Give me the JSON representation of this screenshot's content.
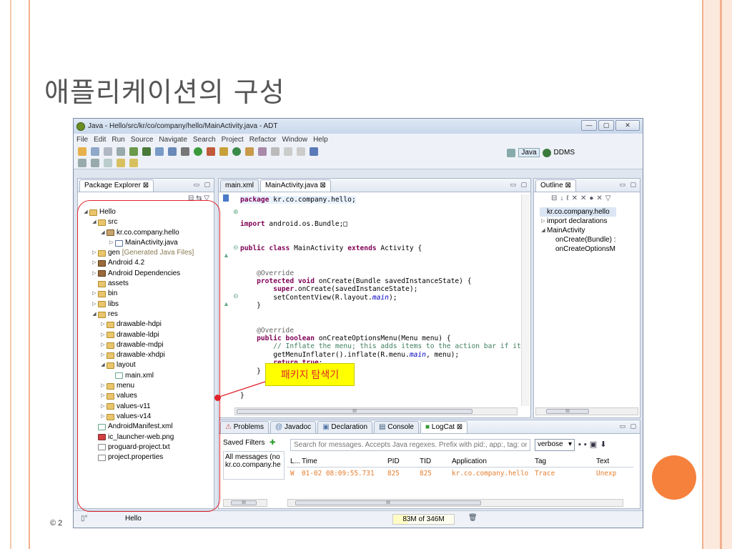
{
  "slide": {
    "title": "애플리케이션의 구성",
    "footer": "© 2",
    "callout": "패키지 탐색기",
    "colors": {
      "accent": "#f5813c",
      "frame": "#f2b08e",
      "callout_bg": "#ffff00",
      "callout_text": "#e0242b"
    }
  },
  "window": {
    "title": "Java - Hello/src/kr/co/company/hello/MainActivity.java - ADT",
    "controls": [
      "—",
      "▢",
      "✕"
    ],
    "menu": [
      "File",
      "Edit",
      "Run",
      "Source",
      "Navigate",
      "Search",
      "Project",
      "Refactor",
      "Window",
      "Help"
    ],
    "perspectives": {
      "java": "Java",
      "ddms": "DDMS"
    }
  },
  "package_explorer": {
    "tab": "Package Explorer ⊠",
    "items": [
      {
        "label": "Hello",
        "indent": 0,
        "twisty": "◢",
        "icon": "project"
      },
      {
        "label": "src",
        "indent": 1,
        "twisty": "◢",
        "icon": "folder"
      },
      {
        "label": "kr.co.company.hello",
        "indent": 2,
        "twisty": "◢",
        "icon": "package"
      },
      {
        "label": "MainActivity.java",
        "indent": 3,
        "twisty": "▷",
        "icon": "java-file"
      },
      {
        "label": "gen",
        "suffix": "[Generated Java Files]",
        "indent": 1,
        "twisty": "▷",
        "icon": "folder"
      },
      {
        "label": "Android 4.2",
        "indent": 1,
        "twisty": "▷",
        "icon": "library"
      },
      {
        "label": "Android Dependencies",
        "indent": 1,
        "twisty": "▷",
        "icon": "library"
      },
      {
        "label": "assets",
        "indent": 1,
        "twisty": "",
        "icon": "folder"
      },
      {
        "label": "bin",
        "indent": 1,
        "twisty": "▷",
        "icon": "folder"
      },
      {
        "label": "libs",
        "indent": 1,
        "twisty": "▷",
        "icon": "folder"
      },
      {
        "label": "res",
        "indent": 1,
        "twisty": "◢",
        "icon": "folder"
      },
      {
        "label": "drawable-hdpi",
        "indent": 2,
        "twisty": "▷",
        "icon": "folder"
      },
      {
        "label": "drawable-ldpi",
        "indent": 2,
        "twisty": "▷",
        "icon": "folder"
      },
      {
        "label": "drawable-mdpi",
        "indent": 2,
        "twisty": "▷",
        "icon": "folder"
      },
      {
        "label": "drawable-xhdpi",
        "indent": 2,
        "twisty": "▷",
        "icon": "folder"
      },
      {
        "label": "layout",
        "indent": 2,
        "twisty": "◢",
        "icon": "folder"
      },
      {
        "label": "main.xml",
        "indent": 3,
        "twisty": "",
        "icon": "xml-file"
      },
      {
        "label": "menu",
        "indent": 2,
        "twisty": "▷",
        "icon": "folder"
      },
      {
        "label": "values",
        "indent": 2,
        "twisty": "▷",
        "icon": "folder"
      },
      {
        "label": "values-v11",
        "indent": 2,
        "twisty": "▷",
        "icon": "folder"
      },
      {
        "label": "values-v14",
        "indent": 2,
        "twisty": "▷",
        "icon": "folder"
      },
      {
        "label": "AndroidManifest.xml",
        "indent": 1,
        "twisty": "",
        "icon": "xml-file"
      },
      {
        "label": "ic_launcher-web.png",
        "indent": 1,
        "twisty": "",
        "icon": "png-file"
      },
      {
        "label": "proguard-project.txt",
        "indent": 1,
        "twisty": "",
        "icon": "text-file"
      },
      {
        "label": "project.properties",
        "indent": 1,
        "twisty": "",
        "icon": "text-file"
      }
    ]
  },
  "editor": {
    "tabs": [
      "main.xml",
      "MainActivity.java ⊠"
    ],
    "scroll_label": "III"
  },
  "outline": {
    "tab": "Outline ⊠",
    "items": [
      {
        "label": "kr.co.company.hello",
        "indent": 0,
        "twisty": ""
      },
      {
        "label": "import declarations",
        "indent": 0,
        "twisty": "▷"
      },
      {
        "label": "MainActivity",
        "indent": 0,
        "twisty": "◢"
      },
      {
        "label": "onCreate(Bundle) :",
        "indent": 1,
        "twisty": ""
      },
      {
        "label": "onCreateOptionsM",
        "indent": 1,
        "twisty": ""
      }
    ],
    "scroll_label": "III"
  },
  "bottom": {
    "tabs": [
      "Problems",
      "Javadoc",
      "Declaration",
      "Console",
      "LogCat ⊠"
    ],
    "saved_filters_label": "Saved Filters",
    "filters": [
      "All messages (no",
      "kr.co.company.he"
    ],
    "search_placeholder": "Search for messages. Accepts Java regexes. Prefix with pid:, app:, tag: or text:",
    "level": "verbose",
    "columns": [
      "L...",
      "Time",
      "PID",
      "TID",
      "Application",
      "Tag",
      "Text"
    ],
    "rows": [
      [
        "W",
        "01-02 08:09:55.731",
        "825",
        "825",
        "kr.co.company.hello",
        "Trace",
        "Unexp"
      ]
    ],
    "scroll_label": "III"
  },
  "status": {
    "project": "Hello",
    "heap": "83M of 346M",
    "heap_used_fraction": 0.24
  }
}
